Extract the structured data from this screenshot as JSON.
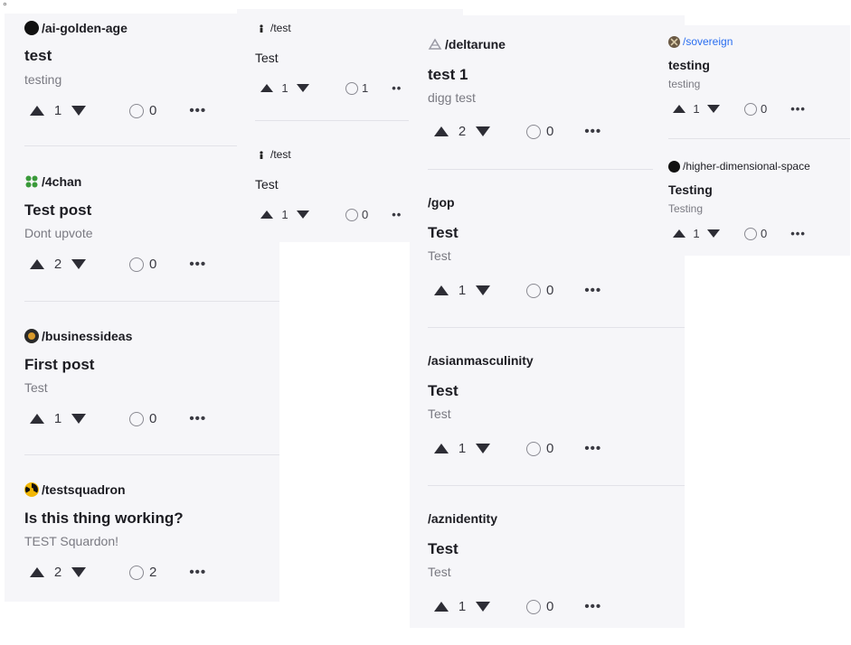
{
  "corner_mark": "°",
  "more_label": "•••",
  "more_label_short": "••",
  "colors": {
    "background": "#f6f6f9",
    "text": "#1c1c22",
    "muted": "#7a7a82",
    "link": "#2a6ef0"
  },
  "columns": [
    {
      "posts": [
        {
          "community": "/ai-golden-age",
          "icon": "black-circle-avatar-icon",
          "title": "test",
          "body": "testing",
          "votes": "1",
          "comments": "0"
        },
        {
          "community": "/4chan",
          "icon": "green-clover-icon",
          "title": "Test post",
          "body": "Dont upvote",
          "votes": "2",
          "comments": "0"
        },
        {
          "community": "/businessideas",
          "icon": "bulb-avatar-icon",
          "title": "First post",
          "body": "Test",
          "votes": "1",
          "comments": "0"
        },
        {
          "community": "/testsquadron",
          "icon": "radiation-avatar-icon",
          "title": "Is this thing working?",
          "body": "TEST Squardon!",
          "votes": "2",
          "comments": "2"
        }
      ]
    },
    {
      "posts": [
        {
          "community": "/test",
          "icon": "small-figure-icon",
          "title": "Test",
          "votes": "1",
          "comments": "1"
        },
        {
          "community": "/test",
          "icon": "small-figure-icon",
          "title": "Test",
          "votes": "1",
          "comments": "0"
        }
      ]
    },
    {
      "posts": [
        {
          "community": "/deltarune",
          "icon": "deltarune-avatar-icon",
          "title": "test 1",
          "body": "digg test",
          "votes": "2",
          "comments": "0"
        },
        {
          "community": "/gop",
          "title": "Test",
          "body": "Test",
          "votes": "1",
          "comments": "0"
        },
        {
          "community": "/asianmasculinity",
          "title": "Test",
          "body": "Test",
          "votes": "1",
          "comments": "0"
        },
        {
          "community": "/aznidentity",
          "title": "Test",
          "body": "Test",
          "votes": "1",
          "comments": "0"
        }
      ]
    },
    {
      "posts": [
        {
          "community": "/sovereign",
          "icon": "sovereign-avatar-icon",
          "title": "testing",
          "body": "testing",
          "votes": "1",
          "comments": "0"
        },
        {
          "community": "/higher-dimensional-space",
          "icon": "black-circle-avatar-icon",
          "title": "Testing",
          "body": "Testing",
          "votes": "1",
          "comments": "0"
        }
      ]
    }
  ]
}
